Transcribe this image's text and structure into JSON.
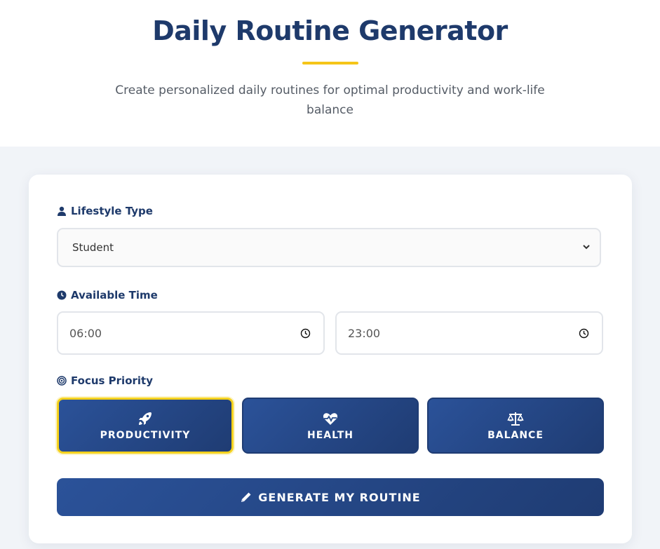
{
  "header": {
    "title": "Daily Routine Generator",
    "subtitle": "Create personalized daily routines for optimal productivity and work-life balance"
  },
  "form": {
    "lifestyle": {
      "label": "Lifestyle Type",
      "selected": "Student"
    },
    "time": {
      "label": "Available Time",
      "start": "06:00",
      "end": "23:00"
    },
    "focus": {
      "label": "Focus Priority",
      "options": [
        {
          "label": "PRODUCTIVITY",
          "icon": "rocket-icon",
          "active": true
        },
        {
          "label": "HEALTH",
          "icon": "heartbeat-icon",
          "active": false
        },
        {
          "label": "BALANCE",
          "icon": "scale-icon",
          "active": false
        }
      ]
    },
    "generate_label": "GENERATE MY ROUTINE"
  },
  "colors": {
    "primary": "#1e3a6b",
    "accent": "#f5c518",
    "button_gradient_start": "#2b5299",
    "button_gradient_end": "#1f3c73"
  }
}
